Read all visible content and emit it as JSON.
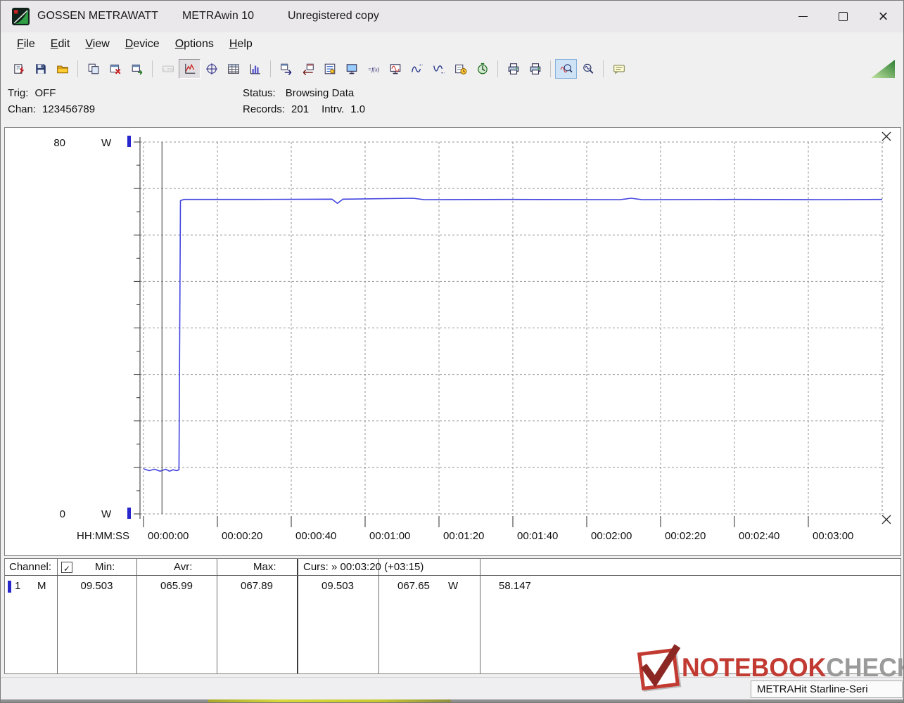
{
  "window": {
    "vendor": "GOSSEN METRAWATT",
    "product": "METRAwin 10",
    "license_note": "Unregistered copy"
  },
  "menu_items": [
    "File",
    "Edit",
    "View",
    "Device",
    "Options",
    "Help"
  ],
  "toolbar": {
    "groups": [
      {
        "icons": [
          {
            "name": "load-data",
            "sym": "open-data"
          },
          {
            "name": "save-data",
            "sym": "save"
          },
          {
            "name": "open-file",
            "sym": "folder"
          }
        ]
      },
      {
        "icons": [
          {
            "name": "copy-window",
            "sym": "copy"
          },
          {
            "name": "close-window",
            "sym": "delwin"
          },
          {
            "name": "export-window",
            "sym": "exportwin"
          }
        ]
      },
      {
        "icons": [
          {
            "name": "numeric-display",
            "sym": "numeric",
            "state": "disabled"
          },
          {
            "name": "yt-chart-view",
            "sym": "chartyt",
            "state": "pressed"
          },
          {
            "name": "xy-chart-view",
            "sym": "chartxy"
          },
          {
            "name": "table-view",
            "sym": "table"
          },
          {
            "name": "histogram-view",
            "sym": "histogram"
          }
        ]
      },
      {
        "icons": [
          {
            "name": "send-to-device",
            "sym": "dev-out"
          },
          {
            "name": "receive-from-device",
            "sym": "dev-in"
          },
          {
            "name": "device-settings",
            "sym": "dev-config"
          },
          {
            "name": "pc-connection",
            "sym": "monitor"
          },
          {
            "name": "formula",
            "sym": "fx"
          },
          {
            "name": "live-monitor",
            "sym": "monitor-wave"
          },
          {
            "name": "signal-upper",
            "sym": "wave-up"
          },
          {
            "name": "signal-lower",
            "sym": "wave-down"
          },
          {
            "name": "transfer-schedule",
            "sym": "send-clock"
          },
          {
            "name": "timer",
            "sym": "timer"
          }
        ]
      },
      {
        "icons": [
          {
            "name": "print-preview",
            "sym": "printer"
          },
          {
            "name": "print",
            "sym": "printer"
          }
        ]
      },
      {
        "icons": [
          {
            "name": "zoom-signal",
            "sym": "zoom-wave",
            "state": "pressed-blue"
          },
          {
            "name": "zoom-tool",
            "sym": "zoom"
          }
        ]
      },
      {
        "icons": [
          {
            "name": "annotation",
            "sym": "note"
          }
        ]
      }
    ]
  },
  "info_panel": {
    "trig_label": "Trig:",
    "trig_value": "OFF",
    "chan_label": "Chan:",
    "chan_value": "123456789",
    "status_label": "Status:",
    "status_value": "Browsing Data",
    "records_label": "Records:",
    "records_value": "201",
    "interval_label": "Intrv.",
    "interval_value": "1.0"
  },
  "colors": {
    "accent_blue": "#4244e0",
    "marker_blue": "#2626cc",
    "grid_gray": "#949494",
    "watermark_red": "#c23b32",
    "watermark_gray": "#9a9a9a",
    "grip_green": "#2e7d32"
  },
  "chart_data": {
    "type": "line",
    "ylabel": "W",
    "ylim": [
      0,
      80
    ],
    "y_major_step": 10,
    "y_minor_step": 5,
    "xlabel": "HH:MM:SS",
    "x_unit": "seconds",
    "x_range": [
      0,
      200
    ],
    "x_tick_interval_s": 20,
    "grid": "dashed",
    "x_ticks": [
      {
        "s": 0,
        "label": "00:00:00"
      },
      {
        "s": 20,
        "label": "00:00:20"
      },
      {
        "s": 40,
        "label": "00:00:40"
      },
      {
        "s": 60,
        "label": "00:01:00"
      },
      {
        "s": 80,
        "label": "00:01:20"
      },
      {
        "s": 100,
        "label": "00:01:40"
      },
      {
        "s": 120,
        "label": "00:02:00"
      },
      {
        "s": 140,
        "label": "00:02:20"
      },
      {
        "s": 160,
        "label": "00:02:40"
      },
      {
        "s": 180,
        "label": "00:03:00"
      }
    ],
    "series": [
      {
        "name": "Channel 1",
        "unit": "W",
        "color": "#4244e0",
        "points": [
          [
            0,
            9.7
          ],
          [
            1.5,
            9.3
          ],
          [
            3,
            9.6
          ],
          [
            4.5,
            9.2
          ],
          [
            6,
            9.6
          ],
          [
            7,
            9.2
          ],
          [
            8,
            9.5
          ],
          [
            9,
            9.3
          ],
          [
            9.6,
            9.5
          ],
          [
            10,
            67.4
          ],
          [
            11,
            67.65
          ],
          [
            30,
            67.65
          ],
          [
            51,
            67.7
          ],
          [
            52.5,
            66.8
          ],
          [
            54,
            67.7
          ],
          [
            73,
            67.9
          ],
          [
            76,
            67.6
          ],
          [
            100,
            67.65
          ],
          [
            129,
            67.6
          ],
          [
            132,
            67.9
          ],
          [
            135,
            67.6
          ],
          [
            160,
            67.65
          ],
          [
            185,
            67.6
          ],
          [
            200,
            67.65
          ]
        ]
      }
    ],
    "cursors": {
      "left_s": 5,
      "right_s": 200,
      "left_value": "09.503",
      "right_value": "067.65",
      "delta": "58.147",
      "label": "Curs: » 00:03:20 (+03:15)"
    }
  },
  "measurements": {
    "header": {
      "channel": "Channel:",
      "checkbox_checked": true,
      "check_glyph": "✓",
      "min": "Min:",
      "avr": "Avr:",
      "max": "Max:",
      "curs": "Curs: » 00:03:20 (+03:15)"
    },
    "row": {
      "channel": "1",
      "mode": "M",
      "min": "09.503",
      "avr": "065.99",
      "max": "067.89",
      "curs_left": "09.503",
      "curs_right": "067.65",
      "unit": "W",
      "delta": "58.147"
    }
  },
  "watermark": {
    "brand_red": "NOTEBOOK",
    "brand_gray": "CHECK"
  },
  "statusbar": {
    "device_model": "METRAHit Starline-Seri"
  },
  "titlebar_glyphs": {
    "close": "×"
  }
}
